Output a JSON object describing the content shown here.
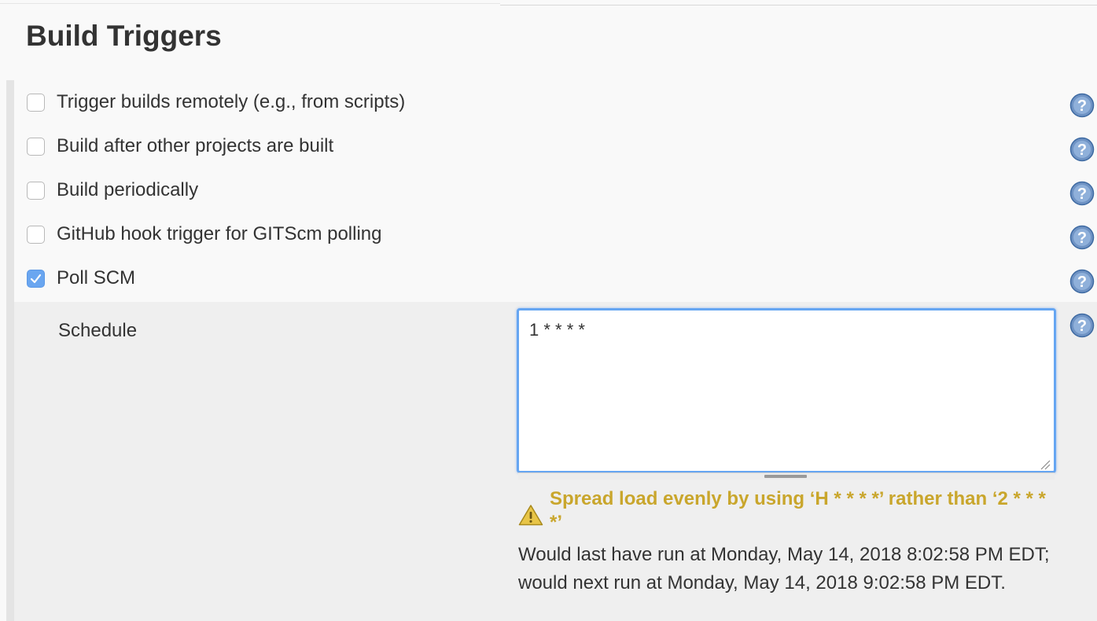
{
  "section": {
    "title": "Build Triggers"
  },
  "triggers": [
    {
      "label": "Trigger builds remotely (e.g., from scripts)",
      "checked": false
    },
    {
      "label": "Build after other projects are built",
      "checked": false
    },
    {
      "label": "Build periodically",
      "checked": false
    },
    {
      "label": "GitHub hook trigger for GITScm polling",
      "checked": false
    },
    {
      "label": "Poll SCM",
      "checked": true
    }
  ],
  "schedule": {
    "label": "Schedule",
    "value": "1 * * * *",
    "warning": "Spread load evenly by using ‘H * * * *’ rather than ‘2 * * * *’",
    "info": "Would last have run at Monday, May 14, 2018 8:02:58 PM EDT; would next run at Monday, May 14, 2018 9:02:58 PM EDT."
  },
  "icons": {
    "help": "help-icon",
    "warning": "warning-icon",
    "checkmark": "checkmark-icon"
  },
  "colors": {
    "checkbox_checked": "#6aa6f0",
    "textarea_focus": "#66a6f2",
    "warning_text": "#c9a62c",
    "help_icon": "#4f7fb8"
  }
}
